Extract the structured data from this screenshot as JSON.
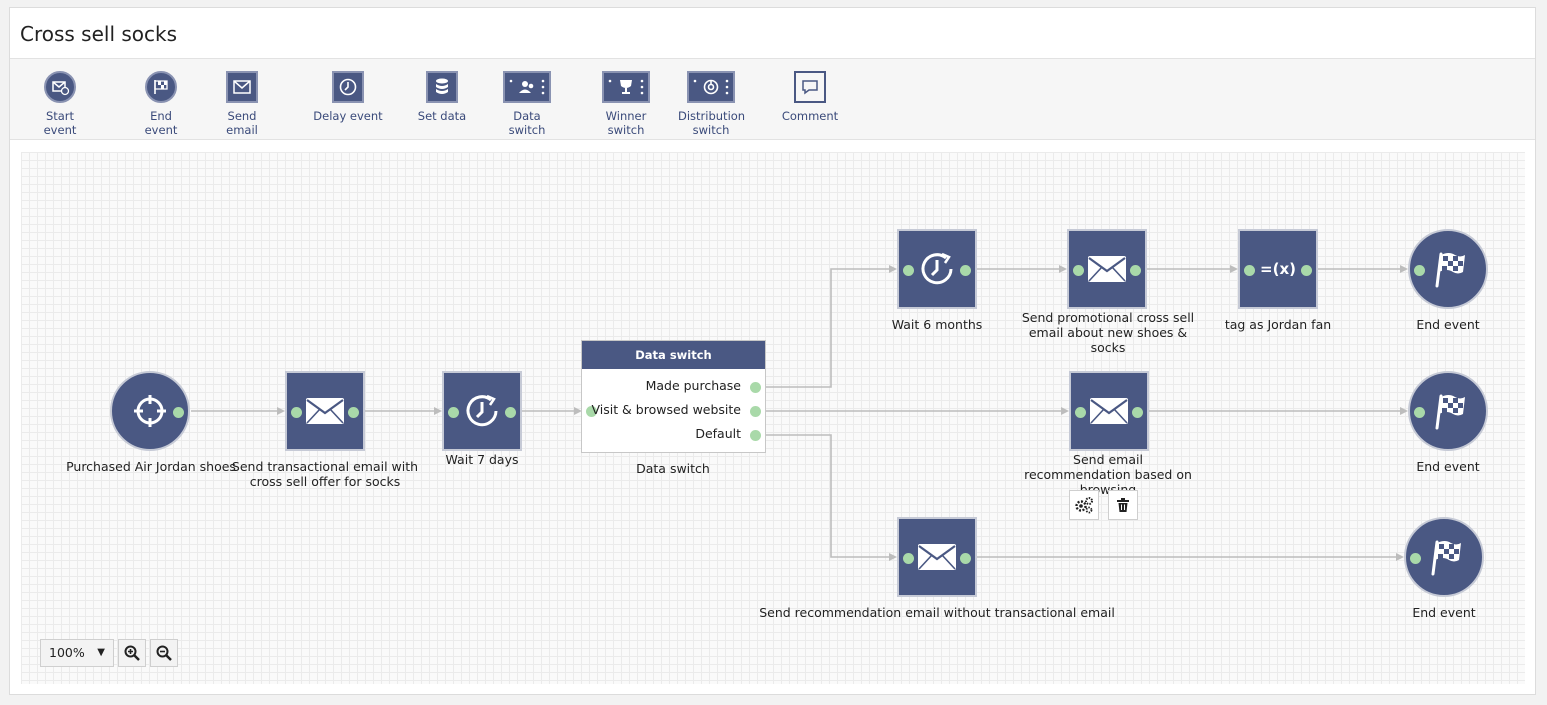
{
  "page": {
    "title": "Cross sell socks"
  },
  "toolbar": [
    {
      "label": "Start event",
      "icon": "start-event-icon"
    },
    {
      "label": "End event",
      "icon": "end-event-icon"
    },
    {
      "label": "Send email",
      "icon": "send-email-icon"
    },
    {
      "label": "Delay event",
      "icon": "delay-event-icon"
    },
    {
      "label": "Set data",
      "icon": "set-data-icon"
    },
    {
      "label": "Data switch",
      "icon": "data-switch-icon"
    },
    {
      "label": "Winner switch",
      "icon": "winner-switch-icon"
    },
    {
      "label": "Distribution switch",
      "icon": "distribution-switch-icon"
    },
    {
      "label": "Comment",
      "icon": "comment-icon"
    }
  ],
  "workflow": {
    "start": {
      "label": "Purchased Air Jordan shoes",
      "icon": "target-icon"
    },
    "send_transactional": {
      "label": "Send transactional email with cross sell offer for socks",
      "icon": "envelope-icon"
    },
    "wait_7": {
      "label": "Wait 7 days",
      "icon": "clock-icon"
    },
    "data_switch": {
      "header": "Data switch",
      "label": "Data switch",
      "branches": [
        "Made purchase",
        "Visit & browsed website",
        "Default"
      ]
    },
    "wait_6": {
      "label": "Wait 6 months",
      "icon": "clock-icon"
    },
    "send_promotional": {
      "label": "Send promotional cross sell email about new shoes & socks",
      "icon": "envelope-icon"
    },
    "tag": {
      "label": "tag as Jordan fan",
      "icon_text": "=(x)",
      "icon": "formula-icon"
    },
    "end_1": {
      "label": "End event",
      "icon": "checkered-flag-icon"
    },
    "send_browsing": {
      "label": "Send email recommendation based on browsing",
      "icon": "envelope-icon"
    },
    "end_2": {
      "label": "End event",
      "icon": "checkered-flag-icon"
    },
    "send_no_transactional": {
      "label": "Send recommendation email without transactional email",
      "icon": "envelope-icon"
    },
    "end_3": {
      "label": "End event",
      "icon": "checkered-flag-icon"
    }
  },
  "node_actions": {
    "settings_icon": "gears-icon",
    "delete_icon": "trash-icon"
  },
  "zoom": {
    "level": "100%",
    "zoom_in_icon": "zoom-in-icon",
    "zoom_out_icon": "zoom-out-icon"
  },
  "colors": {
    "node": "#4a5883",
    "port": "#a9d9a9",
    "wire": "#bdbdbd"
  }
}
